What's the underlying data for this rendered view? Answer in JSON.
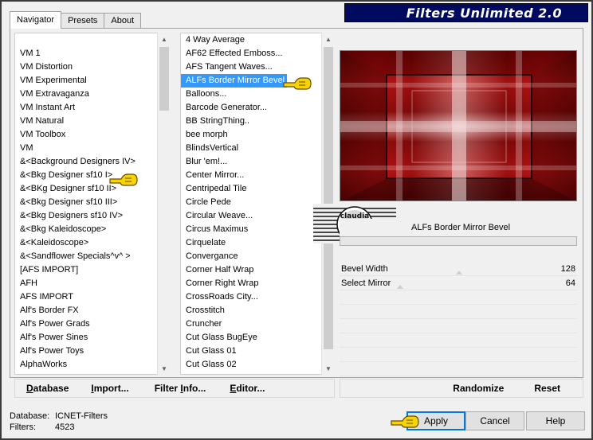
{
  "app": {
    "title": "Filters Unlimited 2.0"
  },
  "tabs": [
    {
      "label": "Navigator",
      "active": true
    },
    {
      "label": "Presets",
      "active": false
    },
    {
      "label": "About",
      "active": false
    }
  ],
  "categories": [
    "VM 1",
    "VM Distortion",
    "VM Experimental",
    "VM Extravaganza",
    "VM Instant Art",
    "VM Natural",
    "VM Toolbox",
    "VM",
    "&<Background Designers IV>",
    "&<Bkg Designer sf10 I>",
    "&<BKg Designer sf10 II>",
    "&<Bkg Designer sf10 III>",
    "&<Bkg Designers sf10 IV>",
    "&<Bkg Kaleidoscope>",
    "&<Kaleidoscope>",
    "&<Sandflower Specials^v^ >",
    "[AFS IMPORT]",
    "AFH",
    "AFS IMPORT",
    "Alf's Border FX",
    "Alf's Power Grads",
    "Alf's Power Sines",
    "Alf's Power Toys",
    "AlphaWorks"
  ],
  "filters": [
    "4 Way Average",
    "AF62 Effected Emboss...",
    "AFS Tangent Waves...",
    "ALFs Border Mirror Bevel",
    "Balloons...",
    "Barcode Generator...",
    "BB StringThing..",
    "bee morph",
    "BlindsVertical",
    "Blur 'em!...",
    "Center Mirror...",
    "Centripedal Tile",
    "Circle Pede",
    "Circular Weave...",
    "Circus Maximus",
    "Cirquelate",
    "Convergance",
    "Corner Half Wrap",
    "Corner Right Wrap",
    "CrossRoads City...",
    "Crosstitch",
    "Cruncher",
    "Cut Glass  BugEye",
    "Cut Glass 01",
    "Cut Glass 02"
  ],
  "selected_filter_index": 3,
  "left_buttons": {
    "database": {
      "underlined": "D",
      "rest": "atabase"
    },
    "import": {
      "underlined": "I",
      "rest": "mport..."
    },
    "filter_info": {
      "pre": "Filter ",
      "underlined": "I",
      "rest": "nfo..."
    },
    "editor": {
      "underlined": "E",
      "rest": "ditor..."
    }
  },
  "right_buttons": {
    "randomize": "Randomize",
    "reset": "Reset"
  },
  "preview": {
    "filter_name": "ALFs Border Mirror Bevel",
    "watermark_text": "claudia"
  },
  "params": [
    {
      "label": "Bevel Width",
      "value": "128"
    },
    {
      "label": "Select Mirror",
      "value": "64"
    }
  ],
  "status": {
    "database_label": "Database:",
    "database_value": "ICNET-Filters",
    "filters_label": "Filters:",
    "filters_value": "4523"
  },
  "buttons": {
    "apply": "Apply",
    "cancel": "Cancel",
    "help": "Help"
  },
  "colors": {
    "title_banner": "#000b60",
    "selection": "#3399ff",
    "preview_red": "#b01010",
    "pointer_hand": "#f5d400"
  }
}
